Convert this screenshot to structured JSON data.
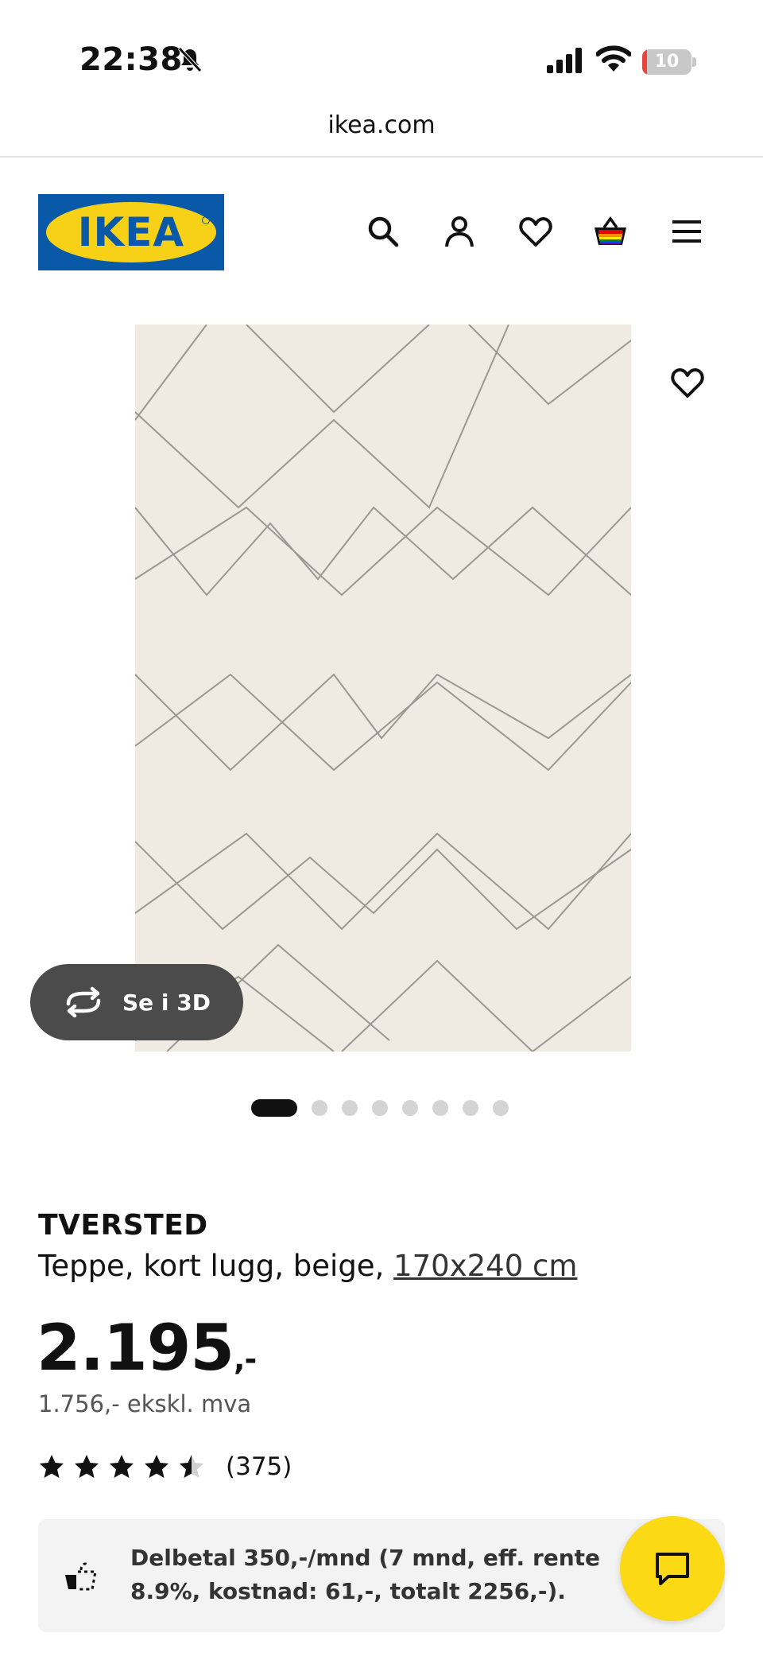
{
  "status_bar": {
    "time": "22:38",
    "battery_level": "10",
    "battery_fraction": 0.1,
    "icons": [
      "bell-slash-icon",
      "cellular-signal-icon",
      "wifi-icon",
      "battery-charging-icon"
    ]
  },
  "browser": {
    "url": "ikea.com"
  },
  "header": {
    "logo_text": "IKEA",
    "icons": [
      "search-icon",
      "account-icon",
      "favorites-icon",
      "shopping-bag-icon",
      "menu-icon"
    ]
  },
  "gallery": {
    "view_3d_label": "Se i 3D",
    "image_count": 8,
    "active_index": 0
  },
  "product": {
    "name": "TVERSTED",
    "description": "Teppe, kort lugg, beige,",
    "size": "170x240 cm",
    "price": "2.195",
    "price_suffix": ",-",
    "price_ex_vat": "1.756,- ekskl. mva",
    "rating": 4.5,
    "review_count": "(375)"
  },
  "financing": {
    "text": "Delbetal 350,-/mnd (7 mnd, eff. rente 8.9%, kostnad: 61,-, totalt 2256,-)."
  },
  "colors": {
    "ikea_blue": "#0a58a8",
    "ikea_yellow": "#f7d117",
    "chat_yellow": "#fbd914",
    "battery_red": "#e8453c"
  }
}
